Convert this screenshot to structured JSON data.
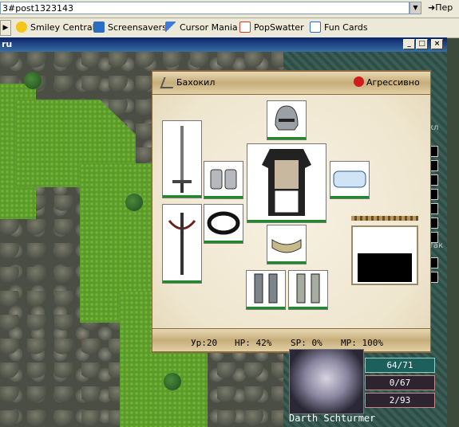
{
  "browser": {
    "address_value": "3#post1323143",
    "go_label": "Пер",
    "links": [
      {
        "label": "Smiley Central",
        "icon": "smiley-icon",
        "color": "#f5c518"
      },
      {
        "label": "Screensavers",
        "icon": "monitor-icon",
        "color": "#2b6cc4"
      },
      {
        "label": "Cursor Mania",
        "icon": "cursor-icon",
        "color": "#3d7be0"
      },
      {
        "label": "PopSwatter",
        "icon": "popup-icon",
        "color": "#d33a2c"
      },
      {
        "label": "Fun Cards",
        "icon": "card-icon",
        "color": "#2d6bd0"
      }
    ]
  },
  "window": {
    "title": "ru",
    "minimize_label": "_",
    "maximize_label": "□",
    "close_label": "×"
  },
  "inventory": {
    "player_name": "Бахокил",
    "stance": "Агрессивно",
    "stats": {
      "level": "Ур:20",
      "hp": "HP: 42%",
      "sp": "SP: 0%",
      "mp": "MP: 100%"
    },
    "slots": [
      "helmet",
      "sword",
      "gauntlets",
      "armor",
      "bracer",
      "crossbow",
      "ring",
      "belt",
      "left-greave",
      "right-greave"
    ]
  },
  "character": {
    "name": "Darth Schturmer",
    "hp": "64/71",
    "sp": "0/67",
    "mp": "2/93"
  },
  "sidebar": {
    "label_top": "кл",
    "label_mid": "так"
  },
  "colors": {
    "accent_red": "#d21c1c",
    "hp_bar": "#1f8a2a",
    "titlebar": "#0a246a"
  }
}
